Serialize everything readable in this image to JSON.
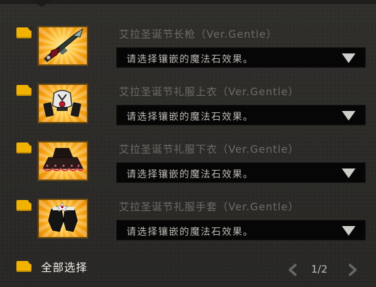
{
  "items": [
    {
      "title": "艾拉圣诞节长枪（Ver.Gentle）",
      "select_value": "请选择镶嵌的魔法石效果。"
    },
    {
      "title": "艾拉圣诞节礼服上衣（Ver.Gentle）",
      "select_value": "请选择镶嵌的魔法石效果。"
    },
    {
      "title": "艾拉圣诞节礼服下衣（Ver.Gentle）",
      "select_value": "请选择镶嵌的魔法石效果。"
    },
    {
      "title": "艾拉圣诞节礼服手套（Ver.Gentle）",
      "select_value": "请选择镶嵌的魔法石效果。"
    }
  ],
  "footer": {
    "select_all_label": "全部选择",
    "page": "1/2"
  },
  "colors": {
    "checkbox": "#f1b300",
    "title_text": "#6e6c68",
    "select_bg": "#060606",
    "select_text": "#bdbab4",
    "background": "#2b2a28"
  },
  "icons": {
    "item_0": "spear-icon",
    "item_1": "armor-top-icon",
    "item_2": "skirt-icon",
    "item_3": "gloves-icon",
    "prev": "chevron-left-icon",
    "next": "chevron-right-icon"
  }
}
